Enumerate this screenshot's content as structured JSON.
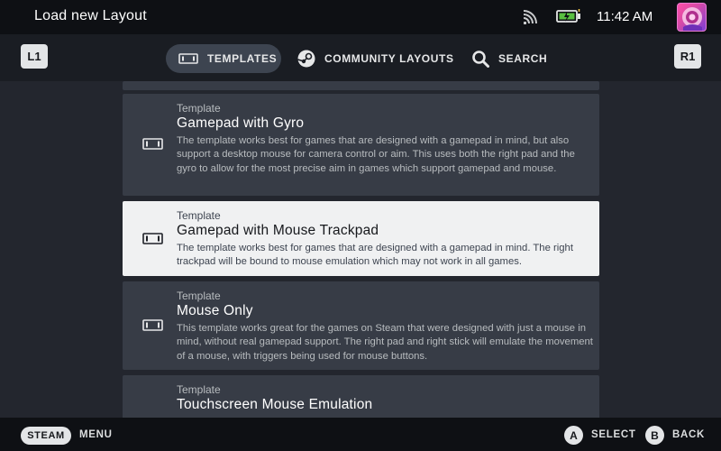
{
  "header": {
    "title": "Load new Layout",
    "clock": "11:42 AM"
  },
  "bumpers": {
    "left": "L1",
    "right": "R1"
  },
  "tabs": [
    {
      "label": "TEMPLATES",
      "icon": "gamepad-icon",
      "active": true
    },
    {
      "label": "COMMUNITY LAYOUTS",
      "icon": "steam-icon",
      "active": false
    },
    {
      "label": "SEARCH",
      "icon": "search-icon",
      "active": false
    }
  ],
  "templates": [
    {
      "kind": "Template",
      "name": "Gamepad with Gyro",
      "description": "The template works best for games that are designed with a gamepad in mind, but also support a desktop mouse for camera control or aim. This uses both the right pad and the gyro to allow for the most precise aim in games which support gamepad and mouse."
    },
    {
      "kind": "Template",
      "name": "Gamepad with Mouse Trackpad",
      "description": "The template works best for games that are designed with a gamepad in mind. The right trackpad will be bound to mouse emulation which may not work in all games.",
      "selected": true
    },
    {
      "kind": "Template",
      "name": "Mouse Only",
      "description": "This template works great for the games on Steam that were designed with just a mouse in mind, without real gamepad support. The right pad and right stick will emulate the movement of a mouse, with triggers being used for mouse buttons."
    },
    {
      "kind": "Template",
      "name": "Touchscreen Mouse Emulation",
      "description": ""
    }
  ],
  "footer": {
    "steam": "STEAM",
    "menu": "MENU",
    "a_button": "A",
    "select": "SELECT",
    "b_button": "B",
    "back": "BACK"
  },
  "colors": {
    "background": "#23262e",
    "card": "#373c46",
    "selected_card": "#f0f1f2",
    "topbar": "#0e1014",
    "active_tab": "#3d4450",
    "battery_green": "#59bf40"
  }
}
